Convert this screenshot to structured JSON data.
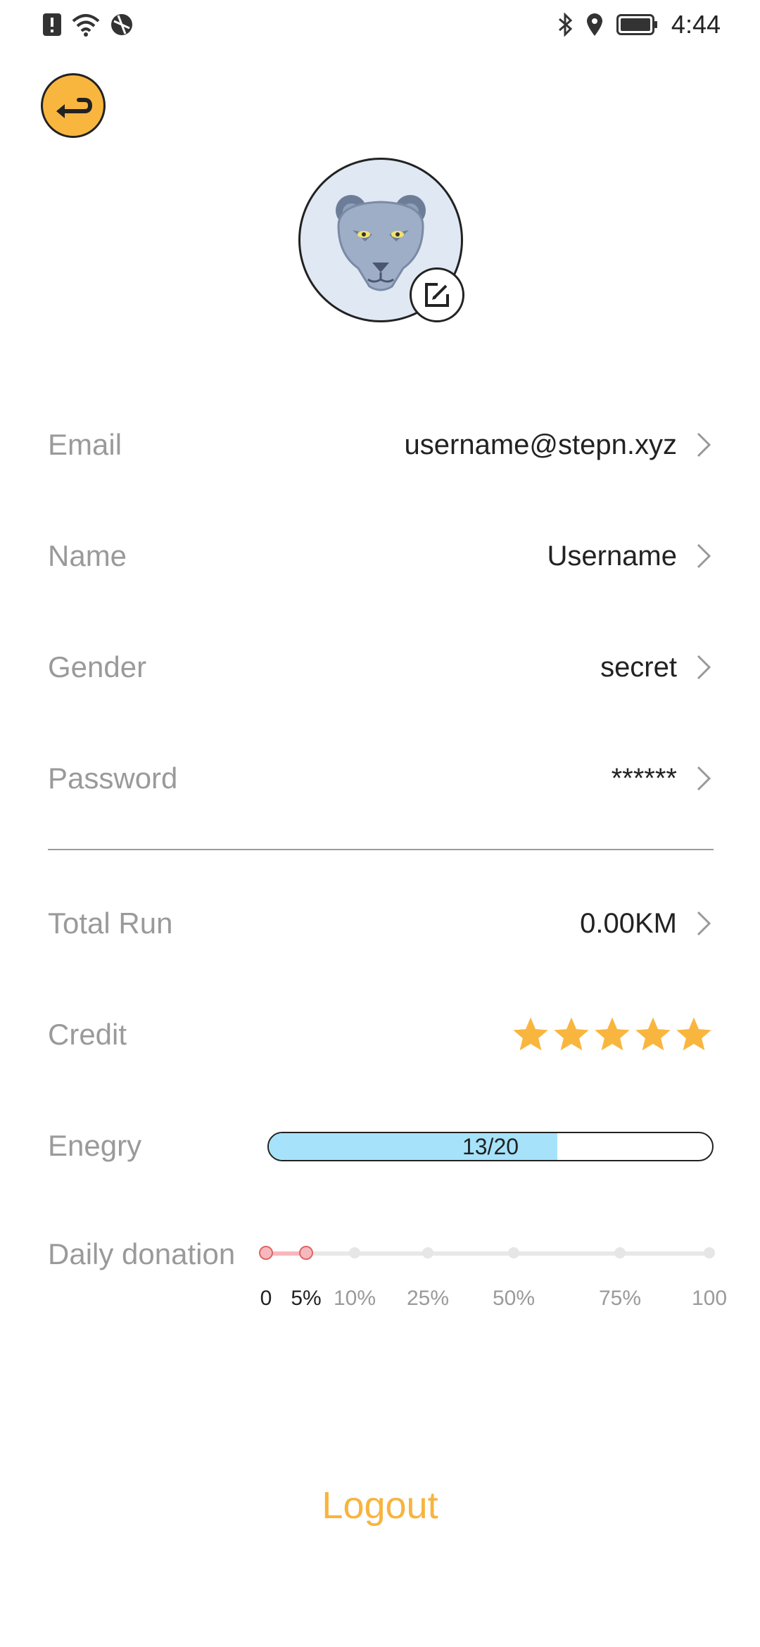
{
  "status_bar": {
    "left_icons": [
      "alert-icon",
      "wifi-icon",
      "vpn-icon"
    ],
    "right_icons": [
      "bluetooth-icon",
      "location-icon",
      "battery-icon"
    ],
    "time": "4:44"
  },
  "header": {
    "back_icon": "back-arrow-icon"
  },
  "profile": {
    "avatar": "panther-avatar",
    "edit_icon": "edit-icon"
  },
  "fields": [
    {
      "label": "Email",
      "value": "username@stepn.xyz"
    },
    {
      "label": "Name",
      "value": "Username"
    },
    {
      "label": "Gender",
      "value": "secret"
    },
    {
      "label": "Password",
      "value": "******"
    }
  ],
  "stats": {
    "total_run": {
      "label": "Total Run",
      "value": "0.00KM"
    },
    "credit": {
      "label": "Credit",
      "stars": 5,
      "max_stars": 5
    },
    "energy": {
      "label": "Enegry",
      "text": "13/20",
      "current": 13,
      "max": 20
    },
    "donation": {
      "label": "Daily donation",
      "ticks": [
        "0",
        "5%",
        "10%",
        "25%",
        "50%",
        "75%",
        "100"
      ],
      "selected_index": 1
    }
  },
  "actions": {
    "logout": "Logout"
  },
  "colors": {
    "accent": "#f7b43d",
    "energy_fill": "#a6e3fa",
    "donation_fill": "#f7b8bd",
    "label_gray": "#9a9a9a"
  }
}
